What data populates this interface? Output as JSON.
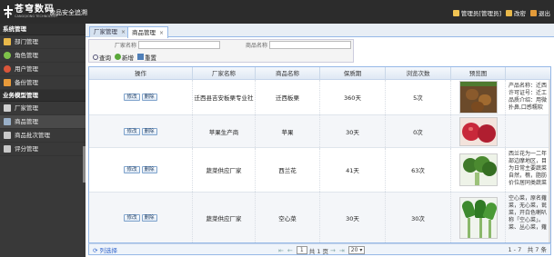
{
  "header": {
    "logo_name": "苍穹数码",
    "logo_sub": "CANGQIONG TECHNOLOGY",
    "app_title": "食品安全追溯",
    "user_label": "管理员[管理员]",
    "change_label": "改密",
    "logout_label": "退出"
  },
  "sidebar": {
    "sections": [
      {
        "title": "系统管理",
        "items": [
          {
            "label": "部门管理",
            "icon": "folder-icon",
            "color": "#e8b84a"
          },
          {
            "label": "角色管理",
            "icon": "role-icon",
            "color": "#7fc24a"
          },
          {
            "label": "用户管理",
            "icon": "user-icon",
            "color": "#d9563a"
          },
          {
            "label": "备份管理",
            "icon": "backup-icon",
            "color": "#e89a3a"
          }
        ]
      },
      {
        "title": "业务模型管理",
        "items": [
          {
            "label": "厂家管理",
            "icon": "edit-icon",
            "color": "#d0d0d0"
          },
          {
            "label": "商品管理",
            "icon": "goods-icon",
            "color": "#9ab0c8"
          },
          {
            "label": "商品批次管理",
            "icon": "batch-icon",
            "color": "#c8c8c8"
          },
          {
            "label": "评分管理",
            "icon": "rating-icon",
            "color": "#c8c8c8"
          }
        ]
      }
    ]
  },
  "tabs": [
    {
      "label": "厂家管理"
    },
    {
      "label": "商品管理"
    }
  ],
  "filter": {
    "maker_label": "厂家名称",
    "maker_value": "",
    "goods_label": "商品名称",
    "goods_value": "",
    "query_label": "查询",
    "add_label": "新增",
    "reset_label": "重置"
  },
  "grid": {
    "columns": [
      "操作",
      "厂家名称",
      "商品名称",
      "保质期",
      "浏览次数",
      "预览图"
    ],
    "edit_label": "修改",
    "delete_label": "删除",
    "rows": [
      {
        "maker": "迁西县吉安板栗专业社",
        "goods": "迁西板栗",
        "shelf": "360天",
        "views": "5次",
        "img": "chestnut-image",
        "desc": [
          "产品名称：迁西",
          "许可证号：迁工",
          "品质介绍：用微",
          "扑鼻,口感糯软"
        ]
      },
      {
        "maker": "苹果生产商",
        "goods": "苹果",
        "shelf": "30天",
        "views": "0次",
        "img": "apple-image",
        "desc": []
      },
      {
        "maker": "蔬菜供应厂家",
        "goods": "西兰花",
        "shelf": "41天",
        "views": "63次",
        "img": "broccoli-image",
        "desc": [
          "西兰花为一二年",
          "部边摩地区，目",
          "为日常主要蔬菜",
          "自然，樵，脂肪",
          "价位居同类蔬菜"
        ]
      },
      {
        "maker": "蔬菜供应厂家",
        "goods": "空心菜",
        "shelf": "30天",
        "views": "30次",
        "img": "water-spinach-image",
        "desc": [
          "空心菜，原名蕹",
          "菜，无心菜，瓮",
          "菜，开白色喇叭",
          "称「空心菜」。",
          "菜、丛心菜，蕹"
        ]
      }
    ]
  },
  "pager": {
    "left_label": "列选择",
    "page_value": "1",
    "total_pages": "共 1 页",
    "page_size": "20",
    "summary": "1 - 7　共 7 条"
  }
}
